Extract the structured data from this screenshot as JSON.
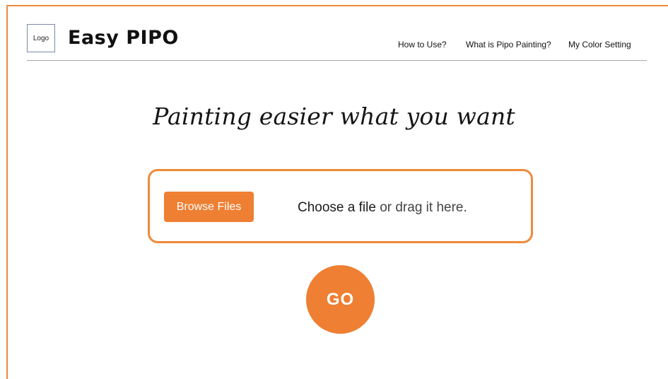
{
  "header": {
    "logo_label": "Logo",
    "brand_name": "Easy PIPO",
    "nav_items": [
      {
        "label": "How to Use?"
      },
      {
        "label": "What is Pipo Painting?"
      },
      {
        "label": "My Color Setting"
      }
    ]
  },
  "main": {
    "headline": "Painting easier what you want",
    "upload": {
      "browse_label": "Browse Files",
      "choose_text": "Choose a file",
      "drag_text": "or drag it here."
    },
    "go_label": "GO"
  },
  "colors": {
    "accent": "#ee7f33",
    "frame_border": "#ee8a3a",
    "divider": "#a8a8a8"
  }
}
